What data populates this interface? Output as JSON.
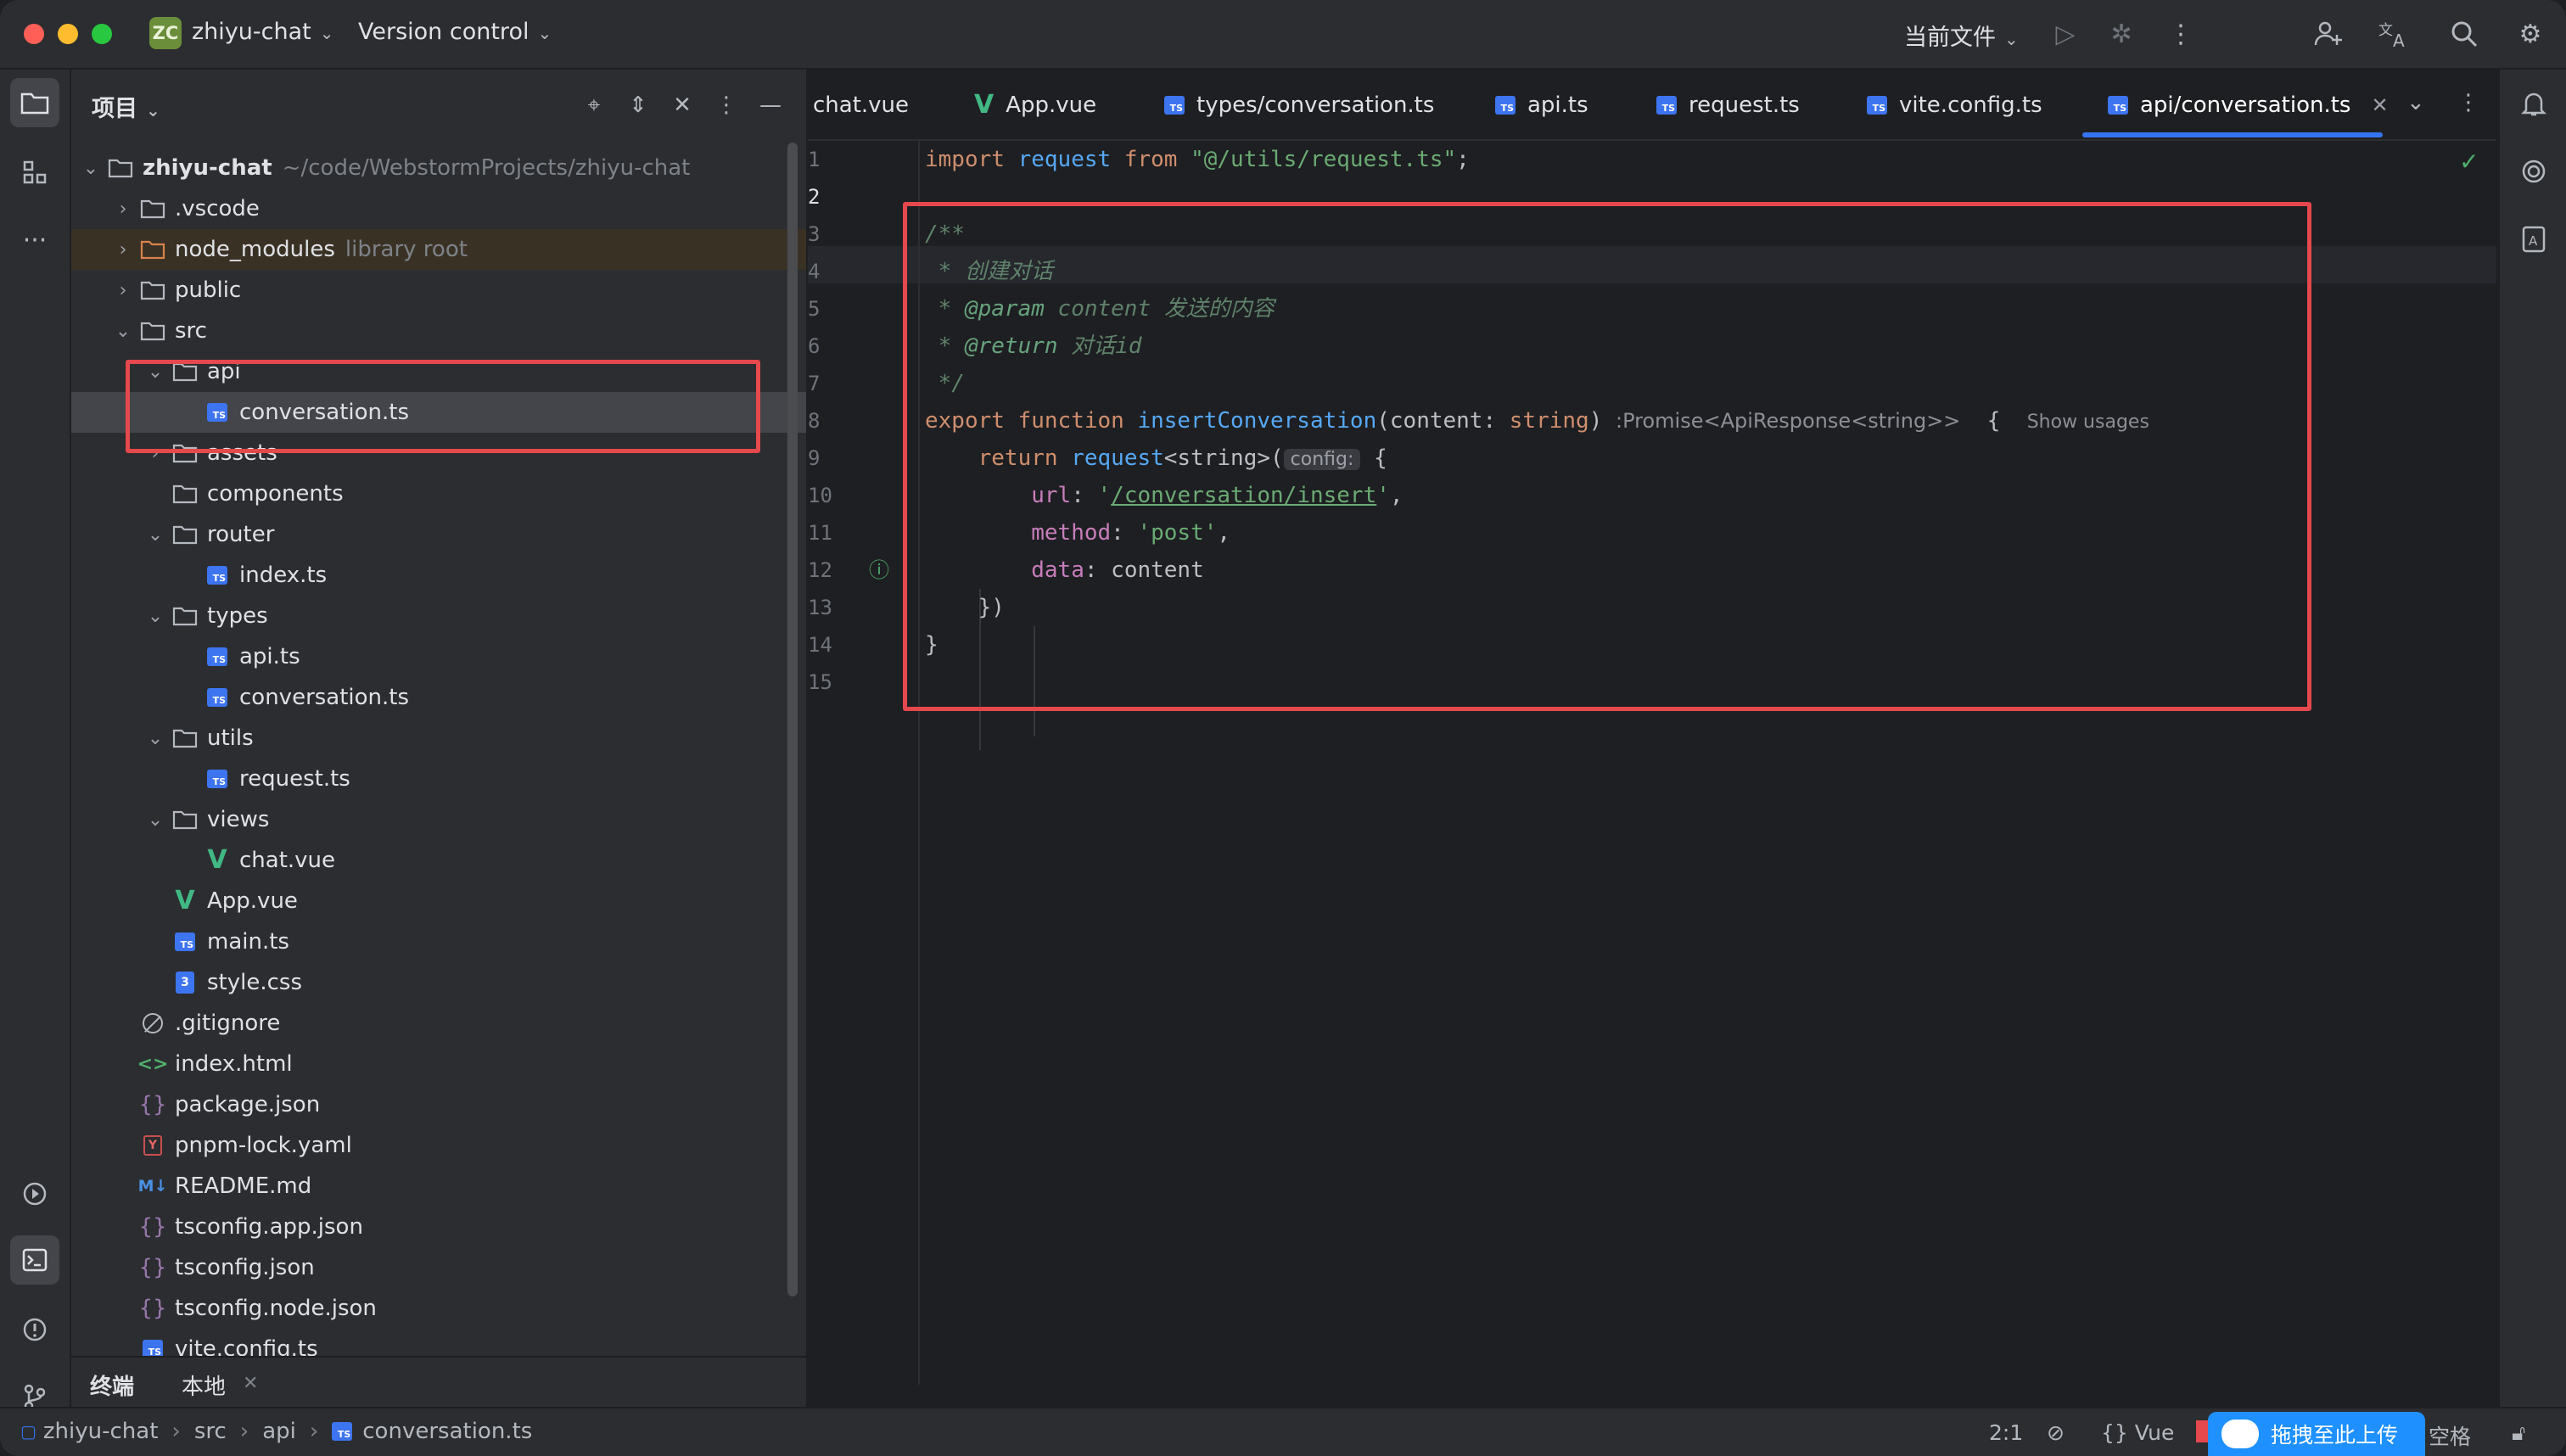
{
  "titlebar": {
    "project_badge": "ZC",
    "project_name": "zhiyu-chat",
    "vcs": "Version control",
    "run_config": "当前文件"
  },
  "project_panel": {
    "title": "项目",
    "tree": [
      {
        "name": "zhiyu-chat",
        "hint": "~/code/WebstormProjects/zhiyu-chat",
        "type": "folder",
        "level": 0,
        "expanded": true
      },
      {
        "name": ".vscode",
        "type": "folder",
        "level": 1,
        "expanded": false
      },
      {
        "name": "node_modules",
        "hint": "library root",
        "type": "folder-lib",
        "level": 1,
        "expanded": false
      },
      {
        "name": "public",
        "type": "folder",
        "level": 1,
        "expanded": false
      },
      {
        "name": "src",
        "type": "folder",
        "level": 1,
        "expanded": true
      },
      {
        "name": "api",
        "type": "folder",
        "level": 2,
        "expanded": true
      },
      {
        "name": "conversation.ts",
        "type": "ts",
        "level": 3,
        "selected": true
      },
      {
        "name": "assets",
        "type": "folder",
        "level": 2,
        "expanded": false
      },
      {
        "name": "components",
        "type": "folder",
        "level": 2
      },
      {
        "name": "router",
        "type": "folder",
        "level": 2,
        "expanded": true
      },
      {
        "name": "index.ts",
        "type": "ts",
        "level": 3
      },
      {
        "name": "types",
        "type": "folder",
        "level": 2,
        "expanded": true
      },
      {
        "name": "api.ts",
        "type": "ts",
        "level": 3
      },
      {
        "name": "conversation.ts",
        "type": "ts",
        "level": 3
      },
      {
        "name": "utils",
        "type": "folder",
        "level": 2,
        "expanded": true
      },
      {
        "name": "request.ts",
        "type": "ts",
        "level": 3
      },
      {
        "name": "views",
        "type": "folder",
        "level": 2,
        "expanded": true
      },
      {
        "name": "chat.vue",
        "type": "vue",
        "level": 3
      },
      {
        "name": "App.vue",
        "type": "vue",
        "level": 2
      },
      {
        "name": "main.ts",
        "type": "ts",
        "level": 2
      },
      {
        "name": "style.css",
        "type": "css",
        "level": 2
      },
      {
        "name": ".gitignore",
        "type": "ignore",
        "level": 1
      },
      {
        "name": "index.html",
        "type": "html",
        "level": 1
      },
      {
        "name": "package.json",
        "type": "json",
        "level": 1
      },
      {
        "name": "pnpm-lock.yaml",
        "type": "yaml",
        "level": 1
      },
      {
        "name": "README.md",
        "type": "md",
        "level": 1
      },
      {
        "name": "tsconfig.app.json",
        "type": "json",
        "level": 1
      },
      {
        "name": "tsconfig.json",
        "type": "json",
        "level": 1
      },
      {
        "name": "tsconfig.node.json",
        "type": "json",
        "level": 1
      },
      {
        "name": "vite.config.ts",
        "type": "ts",
        "level": 1
      }
    ]
  },
  "bottom_tabs": {
    "terminal": "终端",
    "local": "本地"
  },
  "editor": {
    "tabs": [
      {
        "label": "chat.vue",
        "icon": "none"
      },
      {
        "label": "App.vue",
        "icon": "vue"
      },
      {
        "label": "types/conversation.ts",
        "icon": "ts"
      },
      {
        "label": "api.ts",
        "icon": "ts"
      },
      {
        "label": "request.ts",
        "icon": "ts"
      },
      {
        "label": "vite.config.ts",
        "icon": "ts"
      },
      {
        "label": "api/conversation.ts",
        "icon": "ts",
        "active": true
      }
    ],
    "line_numbers": [
      "1",
      "2",
      "3",
      "4",
      "5",
      "6",
      "7",
      "8",
      "9",
      "10",
      "11",
      "12",
      "13",
      "14",
      "15"
    ],
    "code": {
      "l1_import": "import",
      "l1_request": "request",
      "l1_from": "from",
      "l1_path": "\"@/utils/request.ts\"",
      "l1_semi": ";",
      "l3": "/**",
      "l4": " * 创建对话",
      "l5_star": " * ",
      "l5_tag": "@param",
      "l5_rest": " content 发送的内容",
      "l6_star": " * ",
      "l6_tag": "@return",
      "l6_rest": " 对话id",
      "l7": " */",
      "l8_export": "export",
      "l8_function": "function",
      "l8_name": "insertConversation",
      "l8_params_open": "(content: ",
      "l8_type": "string",
      "l8_params_close": ")",
      "l8_inlay": ":Promise<ApiResponse<string>>",
      "l8_brace": "{",
      "l8_usages": "Show usages",
      "l9_return": "return",
      "l9_request": "request",
      "l9_generic": "<string>(",
      "l9_hint": "config:",
      "l9_brace": "{",
      "l10_key": "url",
      "l10_colon": ": ",
      "l10_quote_open": "'",
      "l10_url": "/conversation/insert",
      "l10_quote_close": "'",
      "l10_comma": ",",
      "l11_key": "method",
      "l11_colon": ": ",
      "l11_val": "'post'",
      "l11_comma": ",",
      "l12_key": "data",
      "l12_rest": ": content",
      "l13": "})",
      "l14": "}"
    }
  },
  "statusbar": {
    "crumbs": [
      "zhiyu-chat",
      "src",
      "api",
      "conversation.ts"
    ],
    "position": "2:1",
    "lang": "Vue",
    "upload_label": "拖拽至此上传",
    "indent": "空格"
  },
  "colors": {
    "accent": "#3574f0",
    "highlight_box": "#e5484d"
  }
}
